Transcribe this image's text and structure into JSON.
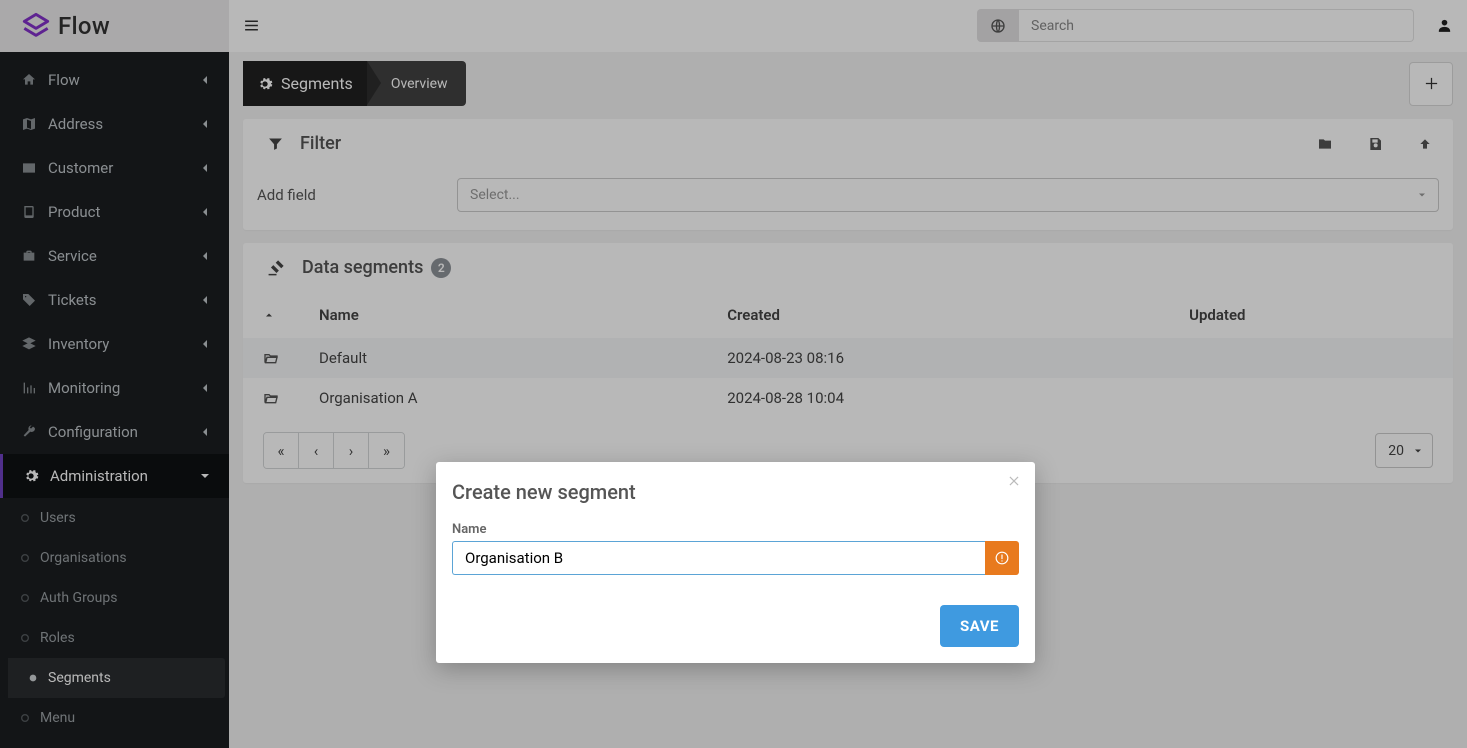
{
  "brand": {
    "name": "Flow"
  },
  "search": {
    "placeholder": "Search"
  },
  "sidebar": {
    "items": [
      {
        "label": "Flow",
        "icon": "home-icon"
      },
      {
        "label": "Address",
        "icon": "map-icon"
      },
      {
        "label": "Customer",
        "icon": "id-card-icon"
      },
      {
        "label": "Product",
        "icon": "book-icon"
      },
      {
        "label": "Service",
        "icon": "briefcase-icon"
      },
      {
        "label": "Tickets",
        "icon": "tag-icon"
      },
      {
        "label": "Inventory",
        "icon": "stack-icon"
      },
      {
        "label": "Monitoring",
        "icon": "chart-icon"
      },
      {
        "label": "Configuration",
        "icon": "wrench-icon"
      },
      {
        "label": "Administration",
        "icon": "gear-icon"
      }
    ],
    "admin_sub": [
      {
        "label": "Users"
      },
      {
        "label": "Organisations"
      },
      {
        "label": "Auth Groups"
      },
      {
        "label": "Roles"
      },
      {
        "label": "Segments"
      },
      {
        "label": "Menu"
      }
    ]
  },
  "breadcrumb": {
    "primary": "Segments",
    "secondary": "Overview"
  },
  "filter": {
    "title": "Filter",
    "add_field_label": "Add field",
    "select_placeholder": "Select..."
  },
  "segments": {
    "title": "Data segments",
    "count": "2",
    "columns": {
      "name": "Name",
      "created": "Created",
      "updated": "Updated"
    },
    "rows": [
      {
        "name": "Default",
        "created": "2024-08-23 08:16",
        "updated": ""
      },
      {
        "name": "Organisation A",
        "created": "2024-08-28 10:04",
        "updated": ""
      }
    ],
    "page_size": "20",
    "pager": {
      "first": "«",
      "prev": "‹",
      "next": "›",
      "last": "»"
    }
  },
  "modal": {
    "title": "Create new segment",
    "name_label": "Name",
    "name_value": "Organisation B",
    "save_label": "SAVE"
  }
}
